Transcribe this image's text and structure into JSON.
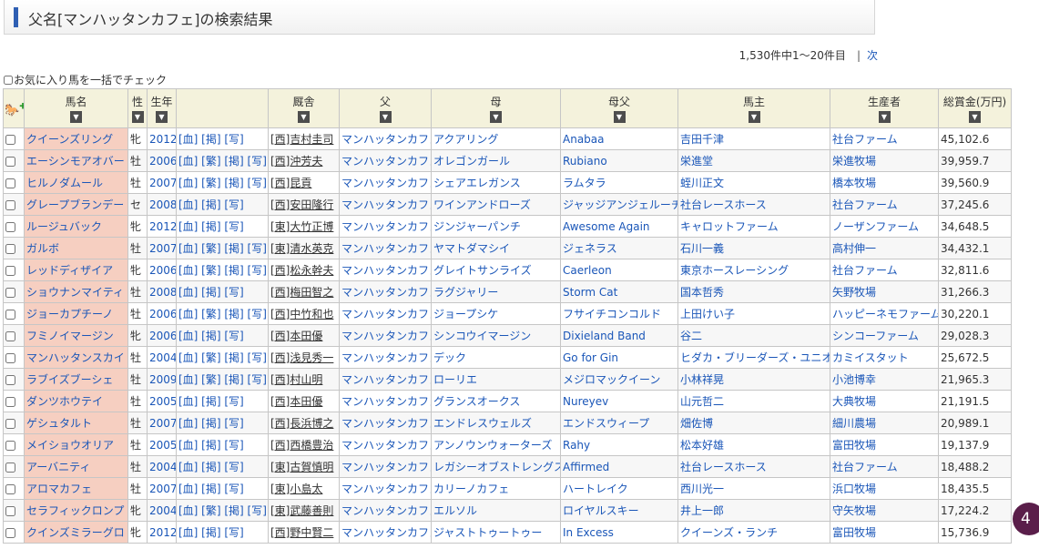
{
  "page": {
    "title": "父名[マンハッタンカフェ]の検索結果"
  },
  "paging": {
    "summary": "1,530件中1～20件目",
    "separator": "|",
    "next_label": "次"
  },
  "bulk_check": {
    "label": "お気に入り馬を一括でチェック"
  },
  "table": {
    "headers": {
      "name": "馬名",
      "sex": "性",
      "year": "生年",
      "links": "",
      "trainer": "厩舎",
      "sire": "父",
      "dam": "母",
      "damsire": "母父",
      "owner": "馬主",
      "breeder": "生産者",
      "earnings": "総賞金(万円)"
    },
    "sort_icon": "▼",
    "favorite_icon": "horse-add-icon",
    "rows": [
      {
        "name": "クイーンズリング",
        "sex": "牝",
        "year": "2012",
        "links": "[血] [掲] [写]",
        "trainer": "[西]吉村圭司",
        "sire": "マンハッタンカフェ",
        "dam": "アクアリング",
        "damsire": "Anabaa",
        "owner": "吉田千津",
        "breeder": "社台ファーム",
        "earnings": "45,102.6"
      },
      {
        "name": "エーシンモアオバー",
        "sex": "牡",
        "year": "2006",
        "links": "[血] [繁] [掲] [写]",
        "trainer": "[西]沖芳夫",
        "sire": "マンハッタンカフェ",
        "dam": "オレゴンガール",
        "damsire": "Rubiano",
        "owner": "栄進堂",
        "breeder": "栄進牧場",
        "earnings": "39,959.7"
      },
      {
        "name": "ヒルノダムール",
        "sex": "牡",
        "year": "2007",
        "links": "[血] [繁] [掲] [写]",
        "trainer": "[西]昆貢",
        "sire": "マンハッタンカフェ",
        "dam": "シェアエレガンス",
        "damsire": "ラムタラ",
        "owner": "蛭川正文",
        "breeder": "橋本牧場",
        "earnings": "39,560.9"
      },
      {
        "name": "グレープブランデー",
        "sex": "セ",
        "year": "2008",
        "links": "[血] [掲] [写]",
        "trainer": "[西]安田隆行",
        "sire": "マンハッタンカフェ",
        "dam": "ワインアンドローズ",
        "damsire": "ジャッジアンジェルーチ",
        "owner": "社台レースホース",
        "breeder": "社台ファーム",
        "earnings": "37,245.6"
      },
      {
        "name": "ルージュバック",
        "sex": "牝",
        "year": "2012",
        "links": "[血] [掲] [写]",
        "trainer": "[東]大竹正博",
        "sire": "マンハッタンカフェ",
        "dam": "ジンジャーパンチ",
        "damsire": "Awesome Again",
        "owner": "キャロットファーム",
        "breeder": "ノーザンファーム",
        "earnings": "34,648.5"
      },
      {
        "name": "ガルボ",
        "sex": "牡",
        "year": "2007",
        "links": "[血] [繁] [掲] [写]",
        "trainer": "[東]清水英克",
        "sire": "マンハッタンカフェ",
        "dam": "ヤマトダマシイ",
        "damsire": "ジェネラス",
        "owner": "石川一義",
        "breeder": "高村伸一",
        "earnings": "34,432.1"
      },
      {
        "name": "レッドディザイア",
        "sex": "牝",
        "year": "2006",
        "links": "[血] [繁] [掲] [写]",
        "trainer": "[西]松永幹夫",
        "sire": "マンハッタンカフェ",
        "dam": "グレイトサンライズ",
        "damsire": "Caerleon",
        "owner": "東京ホースレーシング",
        "breeder": "社台ファーム",
        "earnings": "32,811.6"
      },
      {
        "name": "ショウナンマイティ",
        "sex": "牡",
        "year": "2008",
        "links": "[血] [掲] [写]",
        "trainer": "[西]梅田智之",
        "sire": "マンハッタンカフェ",
        "dam": "ラグジャリー",
        "damsire": "Storm Cat",
        "owner": "国本哲秀",
        "breeder": "矢野牧場",
        "earnings": "31,266.3"
      },
      {
        "name": "ジョーカプチーノ",
        "sex": "牡",
        "year": "2006",
        "links": "[血] [繁] [掲] [写]",
        "trainer": "[西]中竹和也",
        "sire": "マンハッタンカフェ",
        "dam": "ジョープシケ",
        "damsire": "フサイチコンコルド",
        "owner": "上田けい子",
        "breeder": "ハッピーネモファーム",
        "earnings": "30,220.1"
      },
      {
        "name": "フミノイマージン",
        "sex": "牝",
        "year": "2006",
        "links": "[血] [掲] [写]",
        "trainer": "[西]本田優",
        "sire": "マンハッタンカフェ",
        "dam": "シンコウイマージン",
        "damsire": "Dixieland Band",
        "owner": "谷二",
        "breeder": "シンコーファーム",
        "earnings": "29,028.3"
      },
      {
        "name": "マンハッタンスカイ",
        "sex": "牡",
        "year": "2004",
        "links": "[血] [繁] [掲] [写]",
        "trainer": "[西]浅見秀一",
        "sire": "マンハッタンカフェ",
        "dam": "デック",
        "damsire": "Go for Gin",
        "owner": "ヒダカ・ブリーダーズ・ユニオン",
        "breeder": "カミイスタット",
        "earnings": "25,672.5"
      },
      {
        "name": "ラブイズブーシェ",
        "sex": "牡",
        "year": "2009",
        "links": "[血] [繁] [掲] [写]",
        "trainer": "[西]村山明",
        "sire": "マンハッタンカフェ",
        "dam": "ローリエ",
        "damsire": "メジロマックイーン",
        "owner": "小林祥晃",
        "breeder": "小池博幸",
        "earnings": "21,965.3"
      },
      {
        "name": "ダンツホウテイ",
        "sex": "牡",
        "year": "2005",
        "links": "[血] [掲] [写]",
        "trainer": "[西]本田優",
        "sire": "マンハッタンカフェ",
        "dam": "グランスオークス",
        "damsire": "Nureyev",
        "owner": "山元哲二",
        "breeder": "大典牧場",
        "earnings": "21,191.5"
      },
      {
        "name": "ゲシュタルト",
        "sex": "牡",
        "year": "2007",
        "links": "[血] [掲] [写]",
        "trainer": "[西]長浜博之",
        "sire": "マンハッタンカフェ",
        "dam": "エンドレスウェルズ",
        "damsire": "エンドスウィープ",
        "owner": "畑佐博",
        "breeder": "細川農場",
        "earnings": "20,989.1"
      },
      {
        "name": "メイショウオリア",
        "sex": "牡",
        "year": "2005",
        "links": "[血] [掲] [写]",
        "trainer": "[西]西橋豊治",
        "sire": "マンハッタンカフェ",
        "dam": "アンノウンウォーターズ",
        "damsire": "Rahy",
        "owner": "松本好雄",
        "breeder": "富田牧場",
        "earnings": "19,137.9"
      },
      {
        "name": "アーバニティ",
        "sex": "牡",
        "year": "2004",
        "links": "[血] [掲] [写]",
        "trainer": "[東]古賀慎明",
        "sire": "マンハッタンカフェ",
        "dam": "レガシーオブストレングス",
        "damsire": "Affirmed",
        "owner": "社台レースホース",
        "breeder": "社台ファーム",
        "earnings": "18,488.2"
      },
      {
        "name": "アロマカフェ",
        "sex": "牡",
        "year": "2007",
        "links": "[血] [掲] [写]",
        "trainer": "[東]小島太",
        "sire": "マンハッタンカフェ",
        "dam": "カリーノカフェ",
        "damsire": "ハートレイク",
        "owner": "西川光一",
        "breeder": "浜口牧場",
        "earnings": "18,435.5"
      },
      {
        "name": "セラフィックロンプ",
        "sex": "牝",
        "year": "2004",
        "links": "[血] [繁] [掲] [写]",
        "trainer": "[東]武藤善則",
        "sire": "マンハッタンカフェ",
        "dam": "エルソル",
        "damsire": "ロイヤルスキー",
        "owner": "井上一郎",
        "breeder": "守矢牧場",
        "earnings": "17,224.2"
      },
      {
        "name": "クインズミラーグロ",
        "sex": "牝",
        "year": "2012",
        "links": "[血] [掲] [写]",
        "trainer": "[西]野中賢二",
        "sire": "マンハッタンカフェ",
        "dam": "ジャストトゥートゥー",
        "damsire": "In Excess",
        "owner": "クイーンズ・ランチ",
        "breeder": "富田牧場",
        "earnings": "15,736.9"
      }
    ]
  },
  "badge": {
    "label": "4"
  }
}
